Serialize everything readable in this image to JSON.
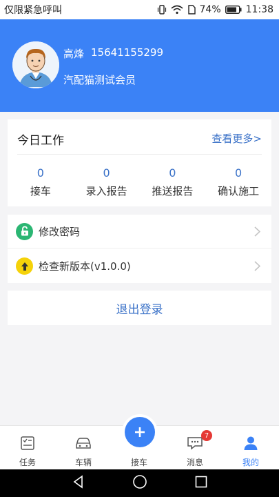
{
  "status_bar": {
    "carrier": "仅限紧急呼叫",
    "battery": "74%",
    "time": "11:38"
  },
  "profile": {
    "name": "高烽",
    "phone": "15641155299",
    "role": "汽配猫测试会员"
  },
  "work": {
    "title": "今日工作",
    "more_label": "查看更多>",
    "stats": [
      {
        "value": "0",
        "label": "接车"
      },
      {
        "value": "0",
        "label": "录入报告"
      },
      {
        "value": "0",
        "label": "推送报告"
      },
      {
        "value": "0",
        "label": "确认施工"
      }
    ]
  },
  "settings": [
    {
      "label": "修改密码",
      "icon": "lock-icon",
      "color": "#2bb673"
    },
    {
      "label": "检查新版本(v1.0.0)",
      "icon": "upload-arrow-icon",
      "color": "#f5d20a"
    }
  ],
  "logout_label": "退出登录",
  "tabbar": {
    "tabs": [
      {
        "label": "任务",
        "icon": "task-icon"
      },
      {
        "label": "车辆",
        "icon": "car-icon"
      },
      {
        "label": "接车",
        "icon": "plus-icon"
      },
      {
        "label": "消息",
        "icon": "message-icon"
      },
      {
        "label": "我的",
        "icon": "person-icon"
      }
    ],
    "message_badge": "7",
    "active_tab": "我的"
  },
  "colors": {
    "brand_blue": "#3b82f6",
    "link_blue": "#3b72c8",
    "badge_red": "#e53935"
  }
}
